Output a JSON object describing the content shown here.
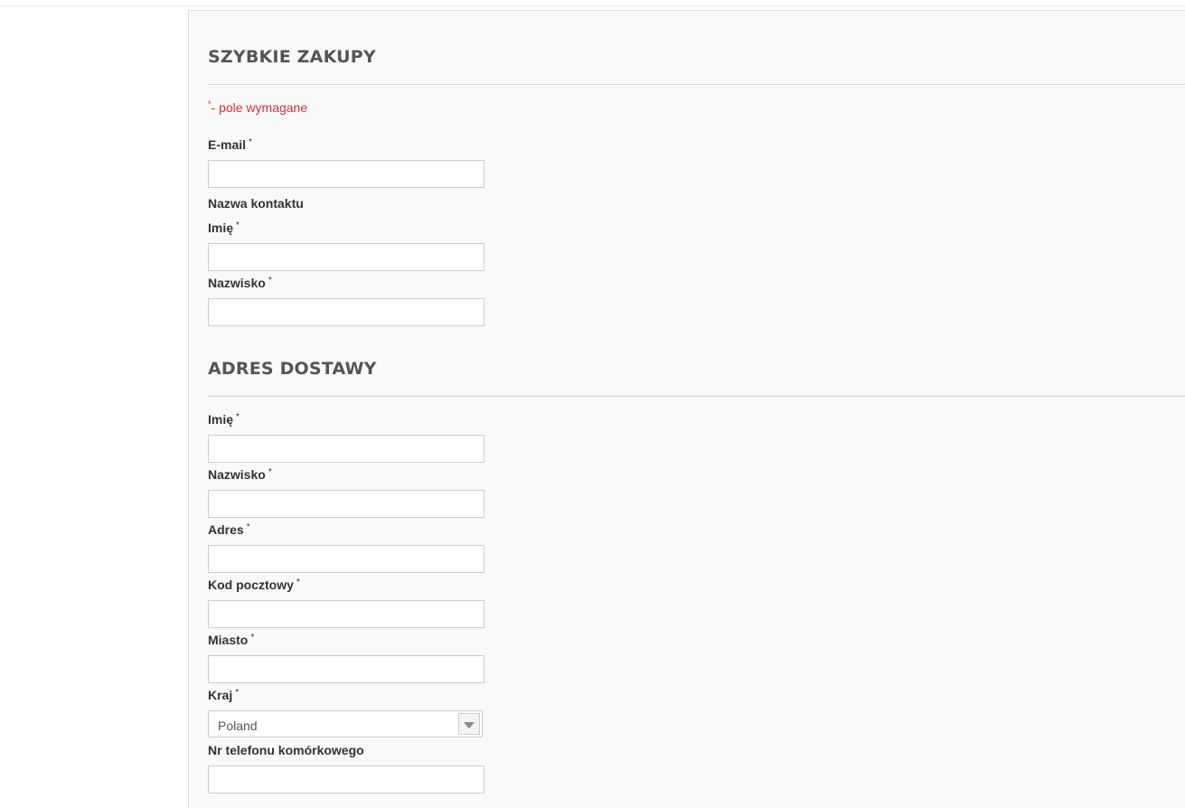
{
  "quick_purchase": {
    "title": "SZYBKIE ZAKUPY",
    "required_note": "- pole wymagane",
    "required_mark": "*",
    "email_label": "E-mail",
    "contact_name_label": "Nazwa kontaktu",
    "first_name_label": "Imię",
    "last_name_label": "Nazwisko"
  },
  "shipping_address": {
    "title": "ADRES DOSTAWY",
    "first_name_label": "Imię",
    "last_name_label": "Nazwisko",
    "address_label": "Adres",
    "postcode_label": "Kod pocztowy",
    "city_label": "Miasto",
    "country_label": "Kraj",
    "country_value": "Poland",
    "mobile_label": "Nr telefonu komórkowego"
  },
  "required_mark": "*",
  "colors": {
    "required_note": "#d0303a",
    "panel_background": "#f9f9f9",
    "heading": "#555555"
  },
  "icons": {
    "country_dropdown": "chevron-down-icon"
  }
}
